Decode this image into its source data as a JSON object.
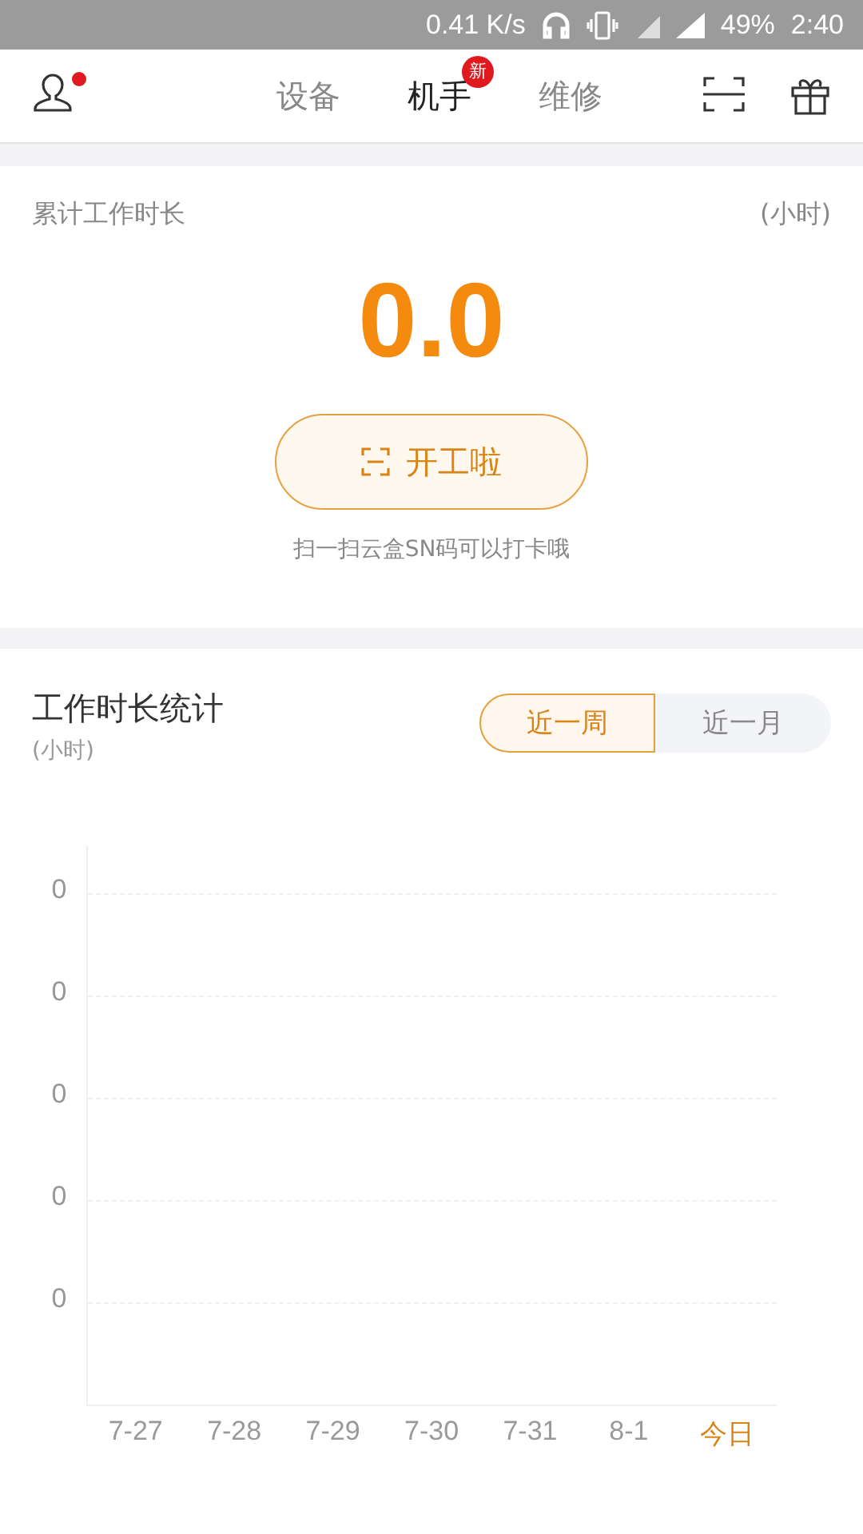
{
  "status_bar": {
    "speed": "0.41 K/s",
    "battery": "49%",
    "time": "2:40"
  },
  "header": {
    "avatar_dot": true,
    "tabs": [
      {
        "label": "设备",
        "selected": false
      },
      {
        "label": "机手",
        "selected": true,
        "badge": "新"
      },
      {
        "label": "维修",
        "selected": false
      }
    ]
  },
  "summary": {
    "title": "累计工作时长",
    "unit": "(小时)",
    "value": "0.0",
    "button": "开工啦",
    "hint": "扫一扫云盒SN码可以打卡哦"
  },
  "stats": {
    "title": "工作时长统计",
    "unit": "(小时)",
    "ranges": [
      {
        "label": "近一周",
        "selected": true
      },
      {
        "label": "近一月",
        "selected": false
      }
    ],
    "y_labels": [
      "0",
      "0",
      "0",
      "0",
      "0"
    ],
    "x_labels": [
      {
        "label": "7-27",
        "selected": false
      },
      {
        "label": "7-28",
        "selected": false
      },
      {
        "label": "7-29",
        "selected": false
      },
      {
        "label": "7-30",
        "selected": false
      },
      {
        "label": "7-31",
        "selected": false
      },
      {
        "label": "8-1",
        "selected": false
      },
      {
        "label": "今日",
        "selected": true
      }
    ]
  }
}
